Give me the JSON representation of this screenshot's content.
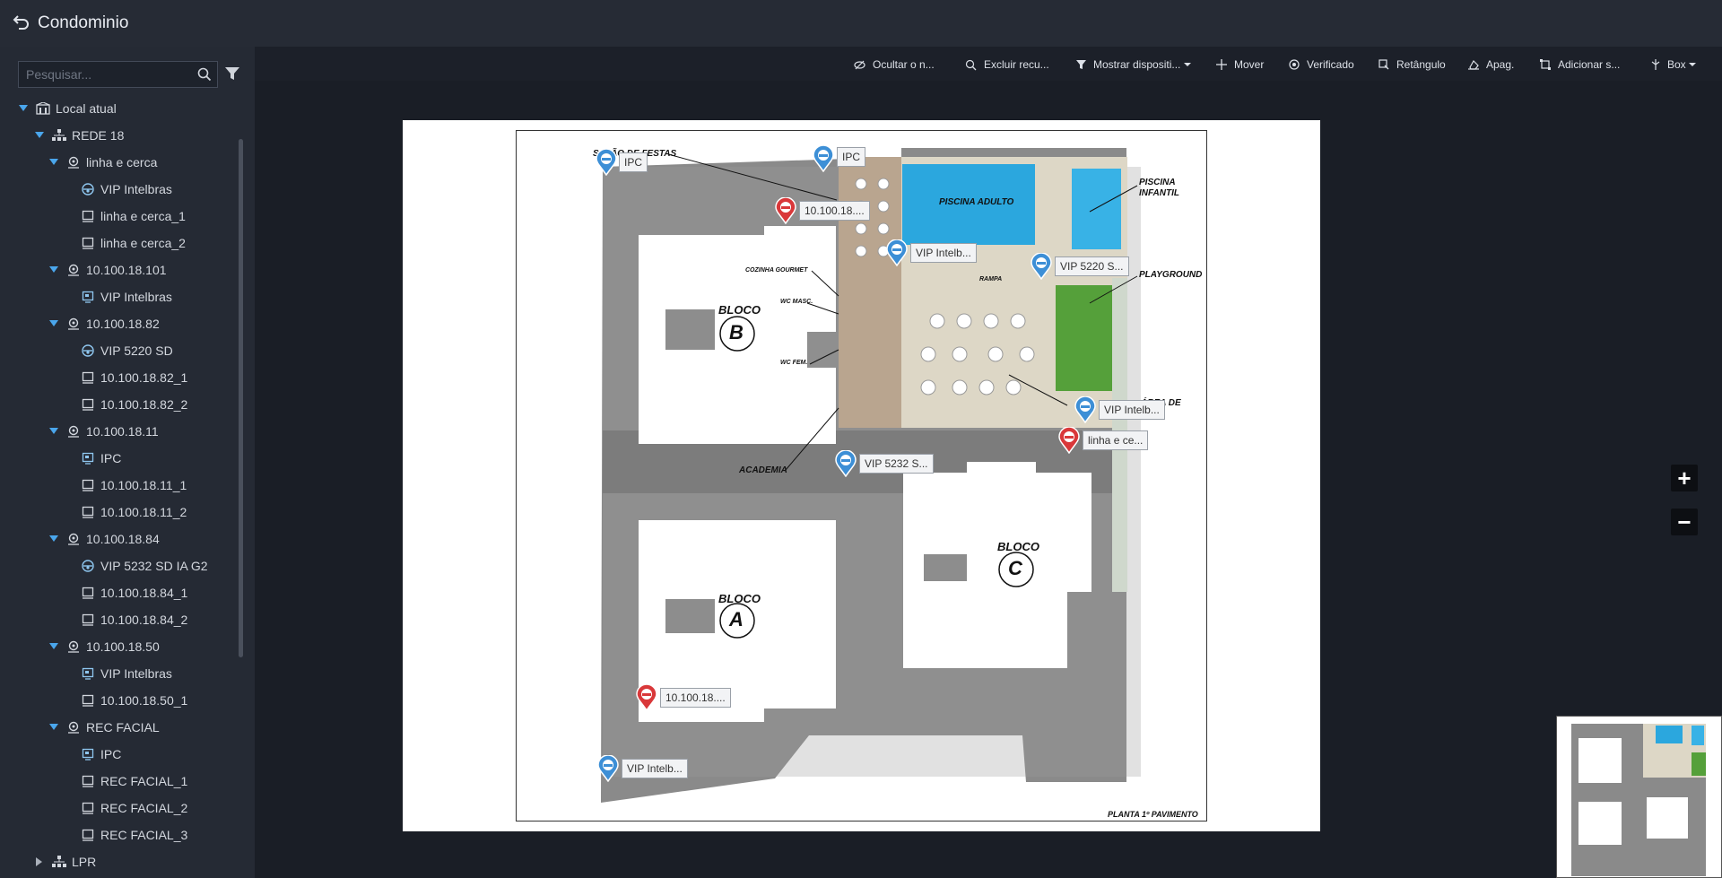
{
  "header": {
    "title": "Condominio"
  },
  "search": {
    "placeholder": "Pesquisar..."
  },
  "tree": {
    "items": [
      {
        "label": "Local atual",
        "level": 0,
        "icon": "site-icon",
        "caret": "down"
      },
      {
        "label": "REDE 18",
        "level": 1,
        "icon": "network-icon",
        "caret": "down"
      },
      {
        "label": "linha e cerca",
        "level": 2,
        "icon": "location-pin-icon",
        "caret": "down"
      },
      {
        "label": "VIP Intelbras",
        "level": 3,
        "icon": "dome-camera-icon"
      },
      {
        "label": "linha e cerca_1",
        "level": 3,
        "icon": "channel-icon"
      },
      {
        "label": "linha e cerca_2",
        "level": 3,
        "icon": "channel-icon"
      },
      {
        "label": "10.100.18.101",
        "level": 2,
        "icon": "location-pin-icon",
        "caret": "down"
      },
      {
        "label": "VIP Intelbras",
        "level": 3,
        "icon": "nvr-icon"
      },
      {
        "label": "10.100.18.82",
        "level": 2,
        "icon": "location-pin-icon",
        "caret": "down"
      },
      {
        "label": "VIP 5220 SD",
        "level": 3,
        "icon": "dome-camera-icon"
      },
      {
        "label": "10.100.18.82_1",
        "level": 3,
        "icon": "channel-icon"
      },
      {
        "label": "10.100.18.82_2",
        "level": 3,
        "icon": "channel-icon"
      },
      {
        "label": "10.100.18.11",
        "level": 2,
        "icon": "location-pin-icon",
        "caret": "down"
      },
      {
        "label": "IPC",
        "level": 3,
        "icon": "nvr-icon"
      },
      {
        "label": "10.100.18.11_1",
        "level": 3,
        "icon": "channel-icon"
      },
      {
        "label": "10.100.18.11_2",
        "level": 3,
        "icon": "channel-icon"
      },
      {
        "label": "10.100.18.84",
        "level": 2,
        "icon": "location-pin-icon",
        "caret": "down"
      },
      {
        "label": "VIP 5232 SD IA G2",
        "level": 3,
        "icon": "dome-camera-icon"
      },
      {
        "label": "10.100.18.84_1",
        "level": 3,
        "icon": "channel-icon"
      },
      {
        "label": "10.100.18.84_2",
        "level": 3,
        "icon": "channel-icon"
      },
      {
        "label": "10.100.18.50",
        "level": 2,
        "icon": "location-pin-icon",
        "caret": "down"
      },
      {
        "label": "VIP Intelbras",
        "level": 3,
        "icon": "nvr-icon"
      },
      {
        "label": "10.100.18.50_1",
        "level": 3,
        "icon": "channel-icon"
      },
      {
        "label": "REC FACIAL",
        "level": 2,
        "icon": "location-pin-icon",
        "caret": "down"
      },
      {
        "label": "IPC",
        "level": 3,
        "icon": "nvr-icon"
      },
      {
        "label": "REC FACIAL_1",
        "level": 3,
        "icon": "channel-icon"
      },
      {
        "label": "REC FACIAL_2",
        "level": 3,
        "icon": "channel-icon"
      },
      {
        "label": "REC FACIAL_3",
        "level": 3,
        "icon": "channel-icon"
      },
      {
        "label": "LPR",
        "level": 1,
        "icon": "network-icon",
        "caret": "right"
      }
    ]
  },
  "toolbar": {
    "hide": "Ocultar o n...",
    "exclude": "Excluir recu...",
    "show_devices": "Mostrar dispositi...",
    "move": "Mover",
    "verified": "Verificado",
    "rectangle": "Retângulo",
    "erase": "Apag.",
    "add": "Adicionar s...",
    "box": "Box"
  },
  "map": {
    "texts": {
      "salao": "SALÃO DE FESTAS",
      "piscina_adulto": "PISCINA ADULTO",
      "piscina_infantil_1": "PISCINA",
      "piscina_infantil_2": "INFANTIL",
      "playground": "PLAYGROUND",
      "cozinha": "COZINHA GOURMET",
      "wc_masc": "WC MASC.",
      "wc_fem": "WC FEM.",
      "rampa": "RAMPA",
      "academia": "ACADEMIA",
      "area_de": "ÁREA DE",
      "bloco": "BLOCO",
      "bloco_a": "A",
      "bloco_b": "B",
      "bloco_c": "C",
      "planta": "PLANTA 1º PAVIMENTO"
    },
    "devices": [
      {
        "label": "IPC",
        "type": "blue"
      },
      {
        "label": "IPC",
        "type": "blue"
      },
      {
        "label": "10.100.18....",
        "type": "red"
      },
      {
        "label": "VIP Intelb...",
        "type": "blue"
      },
      {
        "label": "VIP 5220 S...",
        "type": "blue"
      },
      {
        "label": "VIP Intelb...",
        "type": "blue"
      },
      {
        "label": "linha e ce...",
        "type": "red"
      },
      {
        "label": "VIP 5232 S...",
        "type": "blue"
      },
      {
        "label": "10.100.18....",
        "type": "red"
      },
      {
        "label": "VIP Intelb...",
        "type": "blue"
      }
    ]
  },
  "zoom": {
    "in": "+",
    "out": "−"
  },
  "colors": {
    "accent": "#3a9be0",
    "pin_blue": "#3d8fd6",
    "pin_red": "#d9383a"
  }
}
